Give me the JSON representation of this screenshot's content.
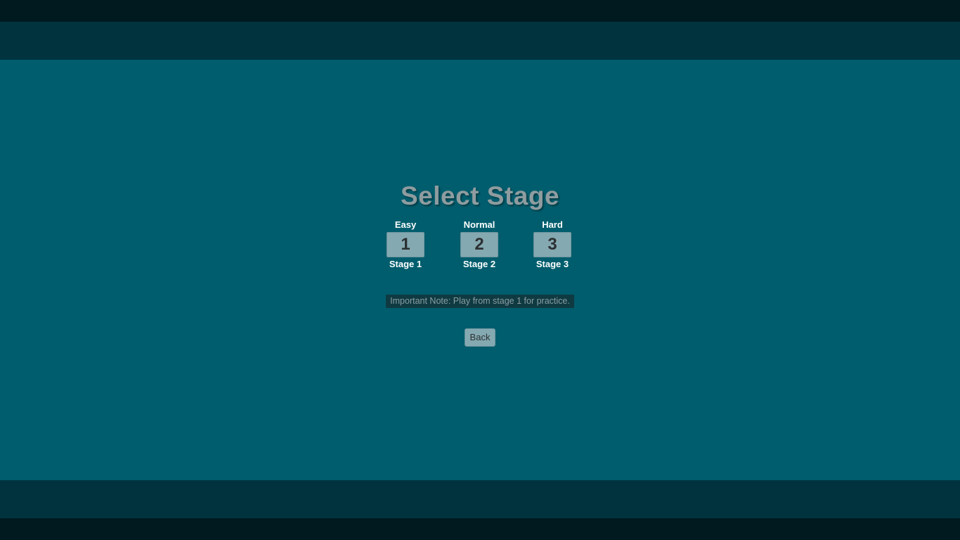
{
  "title": "Select Stage",
  "stages": [
    {
      "difficulty": "Easy",
      "number": "1",
      "label": "Stage 1"
    },
    {
      "difficulty": "Normal",
      "number": "2",
      "label": "Stage 2"
    },
    {
      "difficulty": "Hard",
      "number": "3",
      "label": "Stage 3"
    }
  ],
  "note": "Important Note: Play from stage 1 for practice.",
  "back_label": "Back",
  "colors": {
    "background": "#005d6d",
    "band": "#00333e",
    "outer_band": "#001a20",
    "button": "#85a9b1",
    "title": "#8f9c9f"
  }
}
